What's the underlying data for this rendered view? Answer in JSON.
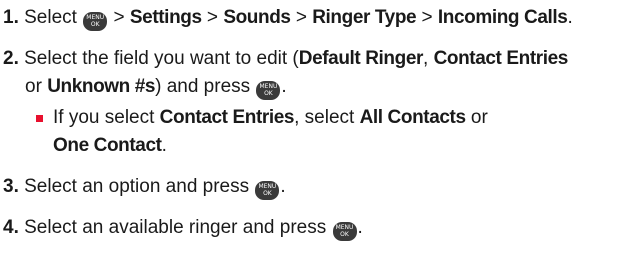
{
  "key_icon": {
    "top": "MENU",
    "bottom": "OK",
    "color": "#3a3a3a"
  },
  "bullet_color": "#e8102e",
  "steps": [
    {
      "num": "1.",
      "pre": " Select ",
      "path_sep": " > ",
      "path": [
        "Settings",
        "Sounds",
        "Ringer Type",
        "Incoming Calls"
      ],
      "end": "."
    },
    {
      "num": "2.",
      "pre": " Select the field you want to edit (",
      "opt1": "Default Ringer",
      "sep1": ", ",
      "opt2": "Contact Entries",
      "line2_pre": "or ",
      "opt3": "Unknown #s",
      "mid": ") and press ",
      "end": "."
    },
    {
      "sub_pre": "If you select ",
      "sub_opt1": "Contact Entries",
      "sub_mid": ", select ",
      "sub_opt2": "All Contacts",
      "sub_or": " or",
      "sub_opt3": "One Contact",
      "sub_end": "."
    },
    {
      "num": "3.",
      "text": " Select an option and press ",
      "end": "."
    },
    {
      "num": "4.",
      "text": " Select an available ringer and press ",
      "end": "."
    }
  ]
}
